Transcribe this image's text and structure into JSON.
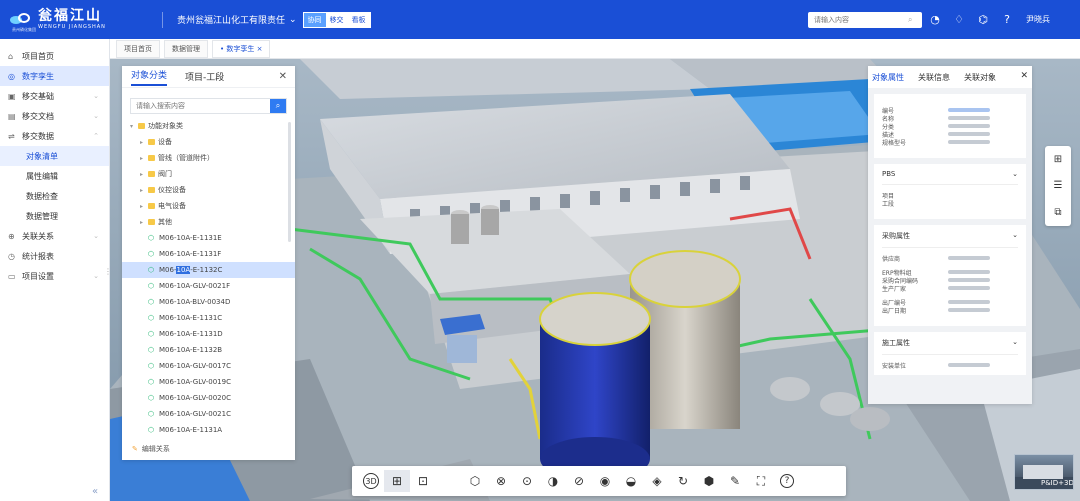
{
  "header": {
    "logo_cn": "瓮福江山",
    "logo_en": "WENGFU JIANGSHAN",
    "logo_sub": "贵州磷化集团",
    "company": "贵州瓮福江山化工有限责任",
    "company_arrow": "⌄",
    "modes": [
      "协同",
      "移交",
      "看板"
    ],
    "active_mode": 0,
    "search_placeholder": "请输入内容",
    "user": "尹晓兵"
  },
  "sidebar": {
    "items": [
      {
        "icon": "home-icon",
        "label": "项目首页"
      },
      {
        "icon": "digital-twin-icon",
        "label": "数字孪生"
      },
      {
        "icon": "handover-icon",
        "label": "移交基础"
      },
      {
        "icon": "document-icon",
        "label": "移交文档"
      },
      {
        "icon": "data-icon",
        "label": "移交数据"
      }
    ],
    "subitems": [
      "对象清单",
      "属性编辑",
      "数据检查",
      "数据管理"
    ],
    "items2": [
      {
        "icon": "relation-icon",
        "label": "关联关系"
      },
      {
        "icon": "report-icon",
        "label": "统计报表"
      },
      {
        "icon": "settings-icon",
        "label": "项目设置"
      }
    ]
  },
  "tabs": [
    "项目首页",
    "数据管理",
    "• 数字孪生 ×"
  ],
  "object_panel": {
    "tabs": [
      "对象分类",
      "项目-工段"
    ],
    "search_placeholder": "请输入搜索内容",
    "root": "功能对象类",
    "folders": [
      "设备",
      "管线（管道附件）",
      "阀门",
      "仪控设备",
      "电气设备",
      "其他"
    ],
    "leaves": [
      "M06-10A-E-1131E",
      "M06-10A-E-1131F",
      "M06-10A-E-1132C",
      "M06-10A-GLV-0021F",
      "M06-10A-BLV-0034D",
      "M06-10A-E-1131C",
      "M06-10A-E-1131D",
      "M06-10A-E-1132B",
      "M06-10A-GLV-0017C",
      "M06-10A-GLV-0019C",
      "M06-10A-GLV-0020C",
      "M06-10A-GLV-0021C",
      "M06-10A-E-1131A"
    ],
    "selected_prefix": "M06-",
    "selected_highlight": "10A",
    "selected_suffix": "-E-1132C",
    "footer": "编辑关系"
  },
  "property_panel": {
    "tabs": [
      "对象属性",
      "关联信息",
      "关联对象"
    ],
    "basic_keys": [
      "编号",
      "名称",
      "分类",
      "描述",
      "规格型号"
    ],
    "pbs": {
      "title": "PBS",
      "keys": [
        "项目",
        "工段"
      ]
    },
    "purchase": {
      "title": "采购属性",
      "keys": [
        "供应商",
        "ERP物料组",
        "采购合同编码",
        "生产厂家",
        "出厂编号",
        "出厂日期"
      ]
    },
    "construction": {
      "title": "施工属性",
      "keys": [
        "安装单位"
      ]
    }
  },
  "side_tools": [
    "model-tree-icon",
    "adjust-icon",
    "layers-icon"
  ],
  "thumbnail_label": "P&ID+3D",
  "toolbar": {
    "buttons": [
      "3d-view-icon",
      "structure-tree-icon",
      "focus-icon",
      "",
      "section-icon",
      "clear-icon",
      "measure-icon",
      "contrast-icon",
      "hide-icon",
      "show-icon",
      "isolate-icon",
      "paint-icon",
      "rotate-icon",
      "cube-icon",
      "ruler-icon",
      "fullscreen-icon",
      "help-icon"
    ],
    "glyphs": [
      "3D",
      "⊞",
      "⊡",
      "",
      "⬡",
      "⊗",
      "⊙",
      "◑",
      "⊘",
      "◉",
      "◒",
      "◈",
      "↻",
      "⬢",
      "✎",
      "⛶",
      "?"
    ]
  }
}
